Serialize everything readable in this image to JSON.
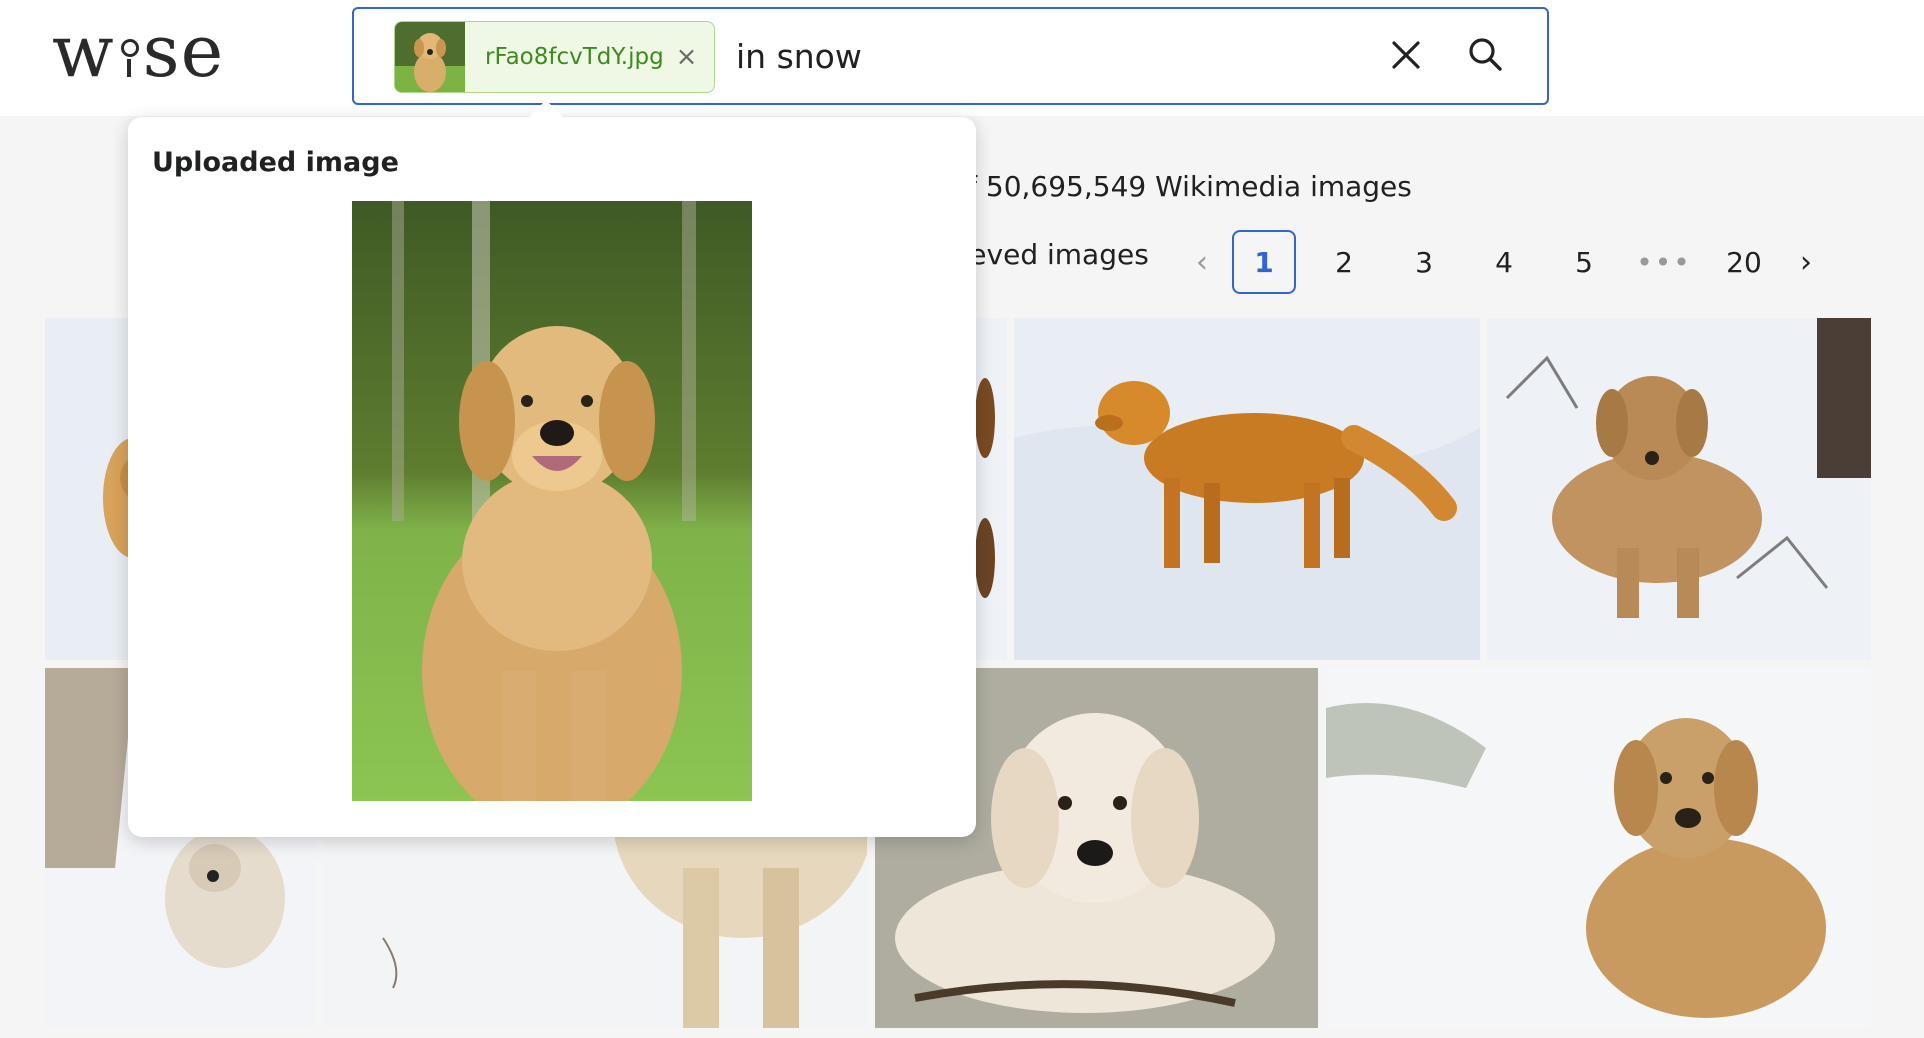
{
  "header": {
    "logo": "wise",
    "chip_filename": "rFao8fcvTdY.jpg",
    "query": "in snow",
    "clear_icon": "close-icon",
    "search_icon": "search-icon"
  },
  "results": {
    "summary": "of 50,695,549 Wikimedia images",
    "retrieved_label": "rieved images"
  },
  "pagination": {
    "prev_icon": "chevron-left-icon",
    "pages": [
      "1",
      "2",
      "3",
      "4",
      "5"
    ],
    "ellipsis": "•••",
    "last": "20",
    "next_icon": "chevron-right-icon",
    "current": "1"
  },
  "popover": {
    "title": "Uploaded image"
  },
  "colors": {
    "accent": "#3366cc",
    "chip_bg": "#eef8e4",
    "chip_border": "#aed78b",
    "chip_text": "#3f8a1e"
  }
}
